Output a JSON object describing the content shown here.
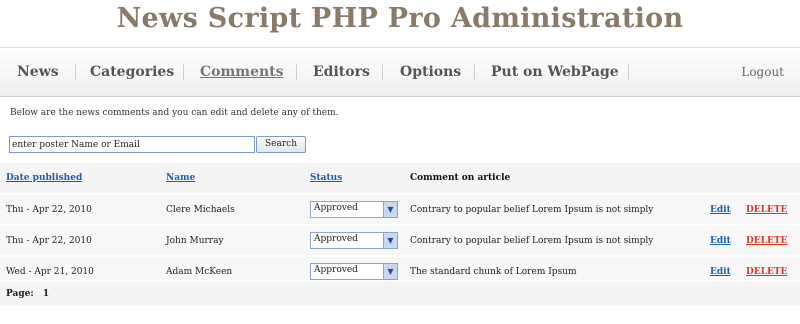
{
  "app": {
    "title": "News Script PHP Pro Administration"
  },
  "nav": {
    "items": [
      {
        "label": "News"
      },
      {
        "label": "Categories"
      },
      {
        "label": "Comments"
      },
      {
        "label": "Editors"
      },
      {
        "label": "Options"
      },
      {
        "label": "Put on WebPage"
      }
    ],
    "active": "Comments",
    "logout": "Logout"
  },
  "intro": "Below are the news comments and you can edit and delete any of them.",
  "search": {
    "value": "enter poster Name or Email",
    "button": "Search"
  },
  "table": {
    "headers": {
      "date": "Date published",
      "name": "Name",
      "status": "Status",
      "comment": "Comment on article"
    },
    "rows": [
      {
        "date": "Thu - Apr 22, 2010",
        "name": "Clere Michaels",
        "status": "Approved",
        "comment": "Contrary to popular belief Lorem Ipsum is not simply",
        "edit": "Edit",
        "delete": "DELETE"
      },
      {
        "date": "Thu - Apr 22, 2010",
        "name": "John Murray",
        "status": "Approved",
        "comment": "Contrary to popular belief Lorem Ipsum is not simply",
        "edit": "Edit",
        "delete": "DELETE"
      },
      {
        "date": "Wed - Apr 21, 2010",
        "name": "Adam McKeen",
        "status": "Approved",
        "comment": "The standard chunk of Lorem Ipsum",
        "edit": "Edit",
        "delete": "DELETE"
      }
    ]
  },
  "pager": {
    "label": "Page:",
    "current": "1"
  },
  "colors": {
    "title": "#8a7a68",
    "link": "#1a5fb4",
    "delete": "#d43a2a"
  }
}
